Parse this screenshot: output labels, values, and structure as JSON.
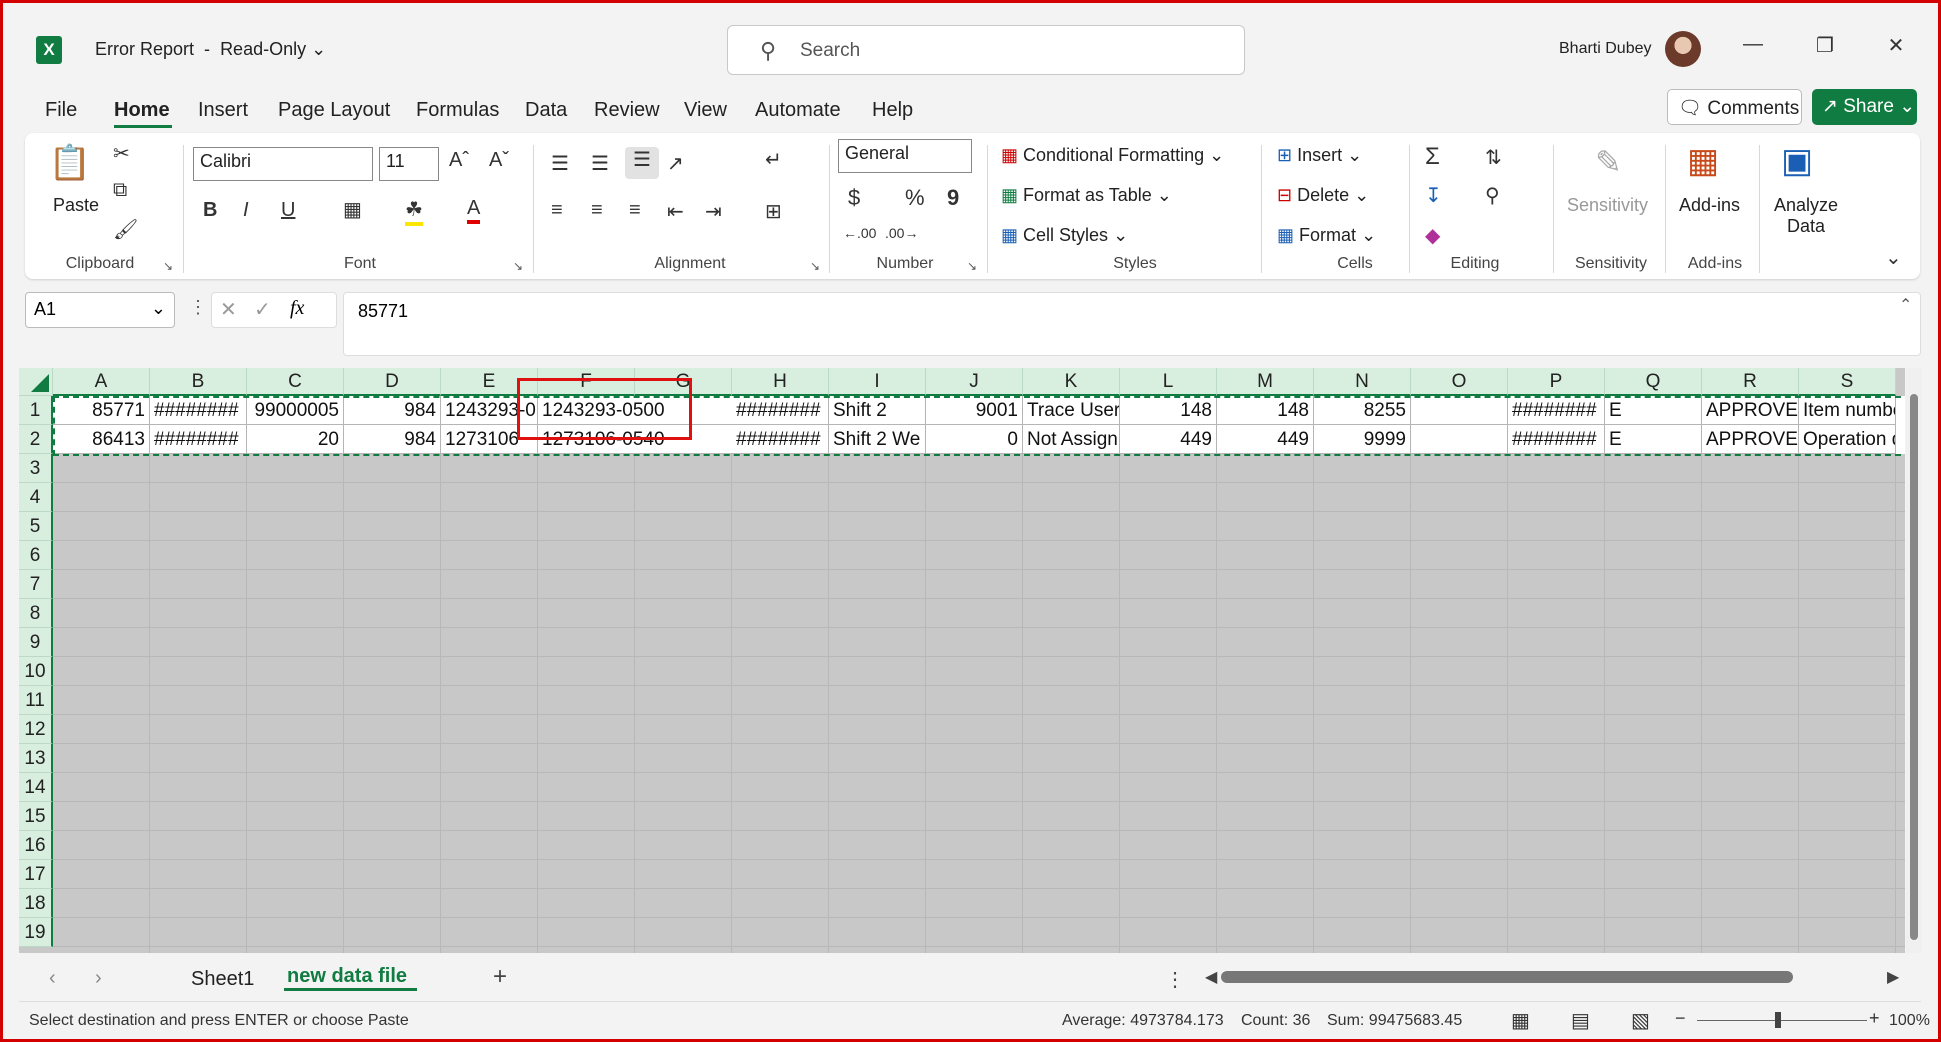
{
  "app": {
    "title": "Error Report",
    "mode": "Read-Only",
    "search_placeholder": "Search",
    "user_name": "Bharti Dubey",
    "brand_color": "#107c41",
    "logo_letter": "X"
  },
  "menu": {
    "items": [
      "File",
      "Home",
      "Insert",
      "Page Layout",
      "Formulas",
      "Data",
      "Review",
      "View",
      "Automate",
      "Help"
    ],
    "active": "Home",
    "comments_label": "Comments",
    "share_label": "Share"
  },
  "ribbon": {
    "clipboard": {
      "paste": "Paste",
      "label": "Clipboard"
    },
    "font": {
      "family": "Calibri",
      "size": "11",
      "bold": "B",
      "italic": "I",
      "underline": "U",
      "label": "Font"
    },
    "alignment": {
      "label": "Alignment"
    },
    "number": {
      "format": "General",
      "currency": "$",
      "percent": "%",
      "comma": "9",
      "label": "Number"
    },
    "styles": {
      "conditional": "Conditional Formatting",
      "format_table": "Format as Table",
      "cell_styles": "Cell Styles",
      "label": "Styles"
    },
    "cells": {
      "insert": "Insert",
      "delete": "Delete",
      "format": "Format",
      "label": "Cells"
    },
    "editing": {
      "label": "Editing"
    },
    "sensitivity": {
      "button": "Sensitivity",
      "label": "Sensitivity"
    },
    "addins": {
      "button": "Add-ins",
      "label": "Add-ins"
    },
    "analyze": {
      "line1": "Analyze",
      "line2": "Data"
    }
  },
  "formula_bar": {
    "name_box": "A1",
    "fx": "fx",
    "value": "85771"
  },
  "grid": {
    "columns": [
      "A",
      "B",
      "C",
      "D",
      "E",
      "F",
      "G",
      "H",
      "I",
      "J",
      "K",
      "L",
      "M",
      "N",
      "O",
      "P",
      "Q",
      "R",
      "S"
    ],
    "rows": [
      "1",
      "2",
      "3",
      "4",
      "5",
      "6",
      "7",
      "8",
      "9",
      "10",
      "11",
      "12",
      "13",
      "14",
      "15",
      "16",
      "17",
      "18",
      "19"
    ],
    "row1": {
      "A": "85771",
      "B": "########",
      "C": "99000005",
      "D": "984",
      "E": "1243293-0",
      "F": "1243293-0500",
      "H": "########",
      "I": "Shift 2",
      "J": "9001",
      "K": "Trace User",
      "L": "148",
      "M": "148",
      "N": "8255",
      "P": "########",
      "Q": "E",
      "R": "APPROVED",
      "S": "Item number"
    },
    "row2": {
      "A": "86413",
      "B": "########",
      "C": "20",
      "D": "984",
      "E": "1273106",
      "F": "1273106-0540",
      "H": "########",
      "I": "Shift 2 We",
      "J": "0",
      "K": "Not Assign",
      "L": "449",
      "M": "449",
      "N": "9999",
      "P": "########",
      "Q": "E",
      "R": "APPROVED",
      "S": "Operation do"
    }
  },
  "sheets": {
    "tabs": [
      "Sheet1",
      "new data file"
    ],
    "active": "new data file",
    "add_label": "+"
  },
  "status": {
    "message": "Select destination and press ENTER or choose Paste",
    "average": "Average: 4973784.173",
    "count": "Count: 36",
    "sum": "Sum: 99475683.45",
    "zoom": "100%"
  }
}
